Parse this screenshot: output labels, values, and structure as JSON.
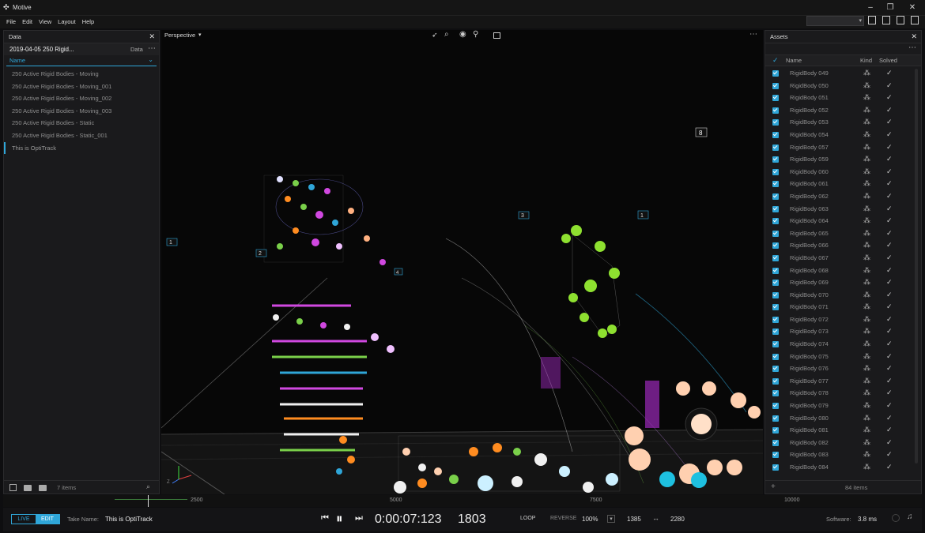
{
  "app": {
    "title": "Motive"
  },
  "menu": [
    "File",
    "Edit",
    "View",
    "Layout",
    "Help"
  ],
  "data_panel": {
    "header": "Data",
    "take_name": "2019-04-05 250 Rigid...",
    "take_suffix": "Data",
    "column_name": "Name",
    "items": [
      "250 Active Rigid Bodies - Moving",
      "250 Active Rigid Bodies - Moving_001",
      "250 Active Rigid Bodies - Moving_002",
      "250 Active Rigid Bodies - Moving_003",
      "250 Active Rigid Bodies - Static",
      "250 Active Rigid Bodies - Static_001",
      "This is OptiTrack"
    ],
    "selected_index": 6,
    "footer_count": "7 items"
  },
  "viewport": {
    "mode_label": "Perspective",
    "camera_labels": [
      "1",
      "2",
      "3",
      "8",
      "1",
      "1",
      "4"
    ]
  },
  "assets_panel": {
    "header": "Assets",
    "col_name": "Name",
    "col_kind": "Kind",
    "col_solved": "Solved",
    "items": [
      "RigidBody 049",
      "RigidBody 050",
      "RigidBody 051",
      "RigidBody 052",
      "RigidBody 053",
      "RigidBody 054",
      "RigidBody 057",
      "RigidBody 059",
      "RigidBody 060",
      "RigidBody 061",
      "RigidBody 062",
      "RigidBody 063",
      "RigidBody 064",
      "RigidBody 065",
      "RigidBody 066",
      "RigidBody 067",
      "RigidBody 068",
      "RigidBody 069",
      "RigidBody 070",
      "RigidBody 071",
      "RigidBody 072",
      "RigidBody 073",
      "RigidBody 074",
      "RigidBody 075",
      "RigidBody 076",
      "RigidBody 077",
      "RigidBody 078",
      "RigidBody 079",
      "RigidBody 080",
      "RigidBody 081",
      "RigidBody 082",
      "RigidBody 083",
      "RigidBody 084"
    ],
    "kind_icon": "rigid-body-icon",
    "solved_icon": "✓",
    "footer_count": "84 items"
  },
  "timeline": {
    "ticks": [
      "2500",
      "5000",
      "7500",
      "10000"
    ]
  },
  "transport": {
    "live_label": "LIVE",
    "edit_label": "EDIT",
    "take_name_label": "Take Name:",
    "take_name_value": "This is OptiTrack",
    "timecode": "0:00:07:123",
    "frame": "1803",
    "loop_label": "LOOP",
    "reverse_label": "REVERSE",
    "speed": "100%",
    "range_start": "1385",
    "range_end": "2280",
    "software_label": "Software:",
    "software_value": "3.8 ms"
  },
  "colors": {
    "accent": "#2fa6d8",
    "bg": "#0e0e10",
    "panel": "#1a1a1c"
  }
}
